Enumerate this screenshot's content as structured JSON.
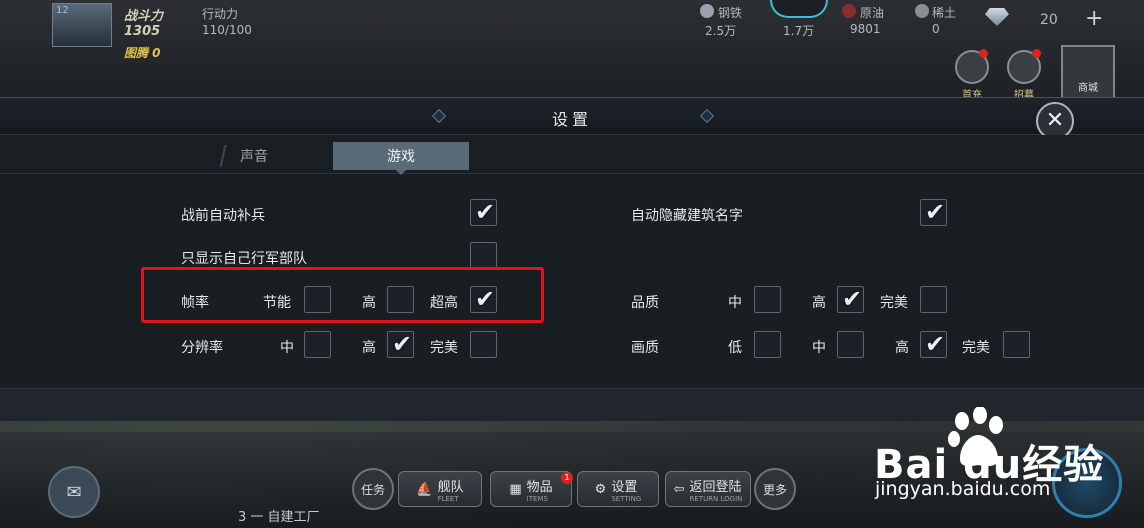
{
  "topbar": {
    "player_level": "12",
    "power_label": "战斗力",
    "power_value": "1305",
    "guild_label": "图腾 0",
    "stamina_label": "行动力",
    "stamina_value": "110/100",
    "resources": [
      {
        "name": "钢铁",
        "value": "2.5万",
        "icon": "steel-icon",
        "color": "#9aa3ab"
      },
      {
        "name": "",
        "value": "1.7万",
        "icon": "energy-icon",
        "color": "#3cc0d8"
      },
      {
        "name": "原油",
        "value": "9801",
        "icon": "oil-icon",
        "color": "#8a2d2d"
      },
      {
        "name": "稀土",
        "value": "0",
        "icon": "rare-earth-icon",
        "color": "#8b8f94"
      }
    ],
    "gems_value": "20",
    "plus_label": "+",
    "first_recharge_label": "首充",
    "recruit_label": "招募",
    "shop_label": "商城"
  },
  "dialog": {
    "title": "设置",
    "close_label": "✕",
    "tabs": [
      {
        "label": "声音",
        "active": false
      },
      {
        "label": "游戏",
        "active": true
      }
    ],
    "settings": {
      "auto_reinforce": {
        "label": "战前自动补兵",
        "checked": true
      },
      "auto_hide_names": {
        "label": "自动隐藏建筑名字",
        "checked": true
      },
      "own_troops_only": {
        "label": "只显示自己行军部队",
        "checked": false
      },
      "frame_rate": {
        "label": "帧率",
        "options": [
          {
            "label": "节能",
            "checked": false
          },
          {
            "label": "高",
            "checked": false
          },
          {
            "label": "超高",
            "checked": true
          }
        ]
      },
      "quality": {
        "label": "品质",
        "options": [
          {
            "label": "中",
            "checked": false
          },
          {
            "label": "高",
            "checked": true
          },
          {
            "label": "完美",
            "checked": false
          }
        ]
      },
      "resolution": {
        "label": "分辨率",
        "options": [
          {
            "label": "中",
            "checked": false
          },
          {
            "label": "高",
            "checked": true
          },
          {
            "label": "完美",
            "checked": false
          }
        ]
      },
      "image_quality": {
        "label": "画质",
        "options": [
          {
            "label": "低",
            "checked": false
          },
          {
            "label": "中",
            "checked": false
          },
          {
            "label": "高",
            "checked": true
          },
          {
            "label": "完美",
            "checked": false
          }
        ]
      }
    },
    "check_glyph": "✔"
  },
  "bottombar": {
    "task_label": "任务",
    "fleet_label": "舰队",
    "fleet_sub": "FLEET",
    "items_label": "物品",
    "items_sub": "ITEMS",
    "items_badge": "1",
    "settings_label": "设置",
    "settings_sub": "SETTING",
    "return_label": "返回登陆",
    "return_sub": "RETURN LOGIN",
    "more_label": "更多",
    "chat_icon": "chat-icon",
    "bottom_text": "3  一 自建工厂"
  },
  "watermark": {
    "logo_text": "Bai   du经验",
    "url": "jingyan.baidu.com"
  },
  "colors": {
    "highlight": "#e0141c",
    "active_tab": "#5b6a78",
    "dialog_bg": "#191e23"
  }
}
